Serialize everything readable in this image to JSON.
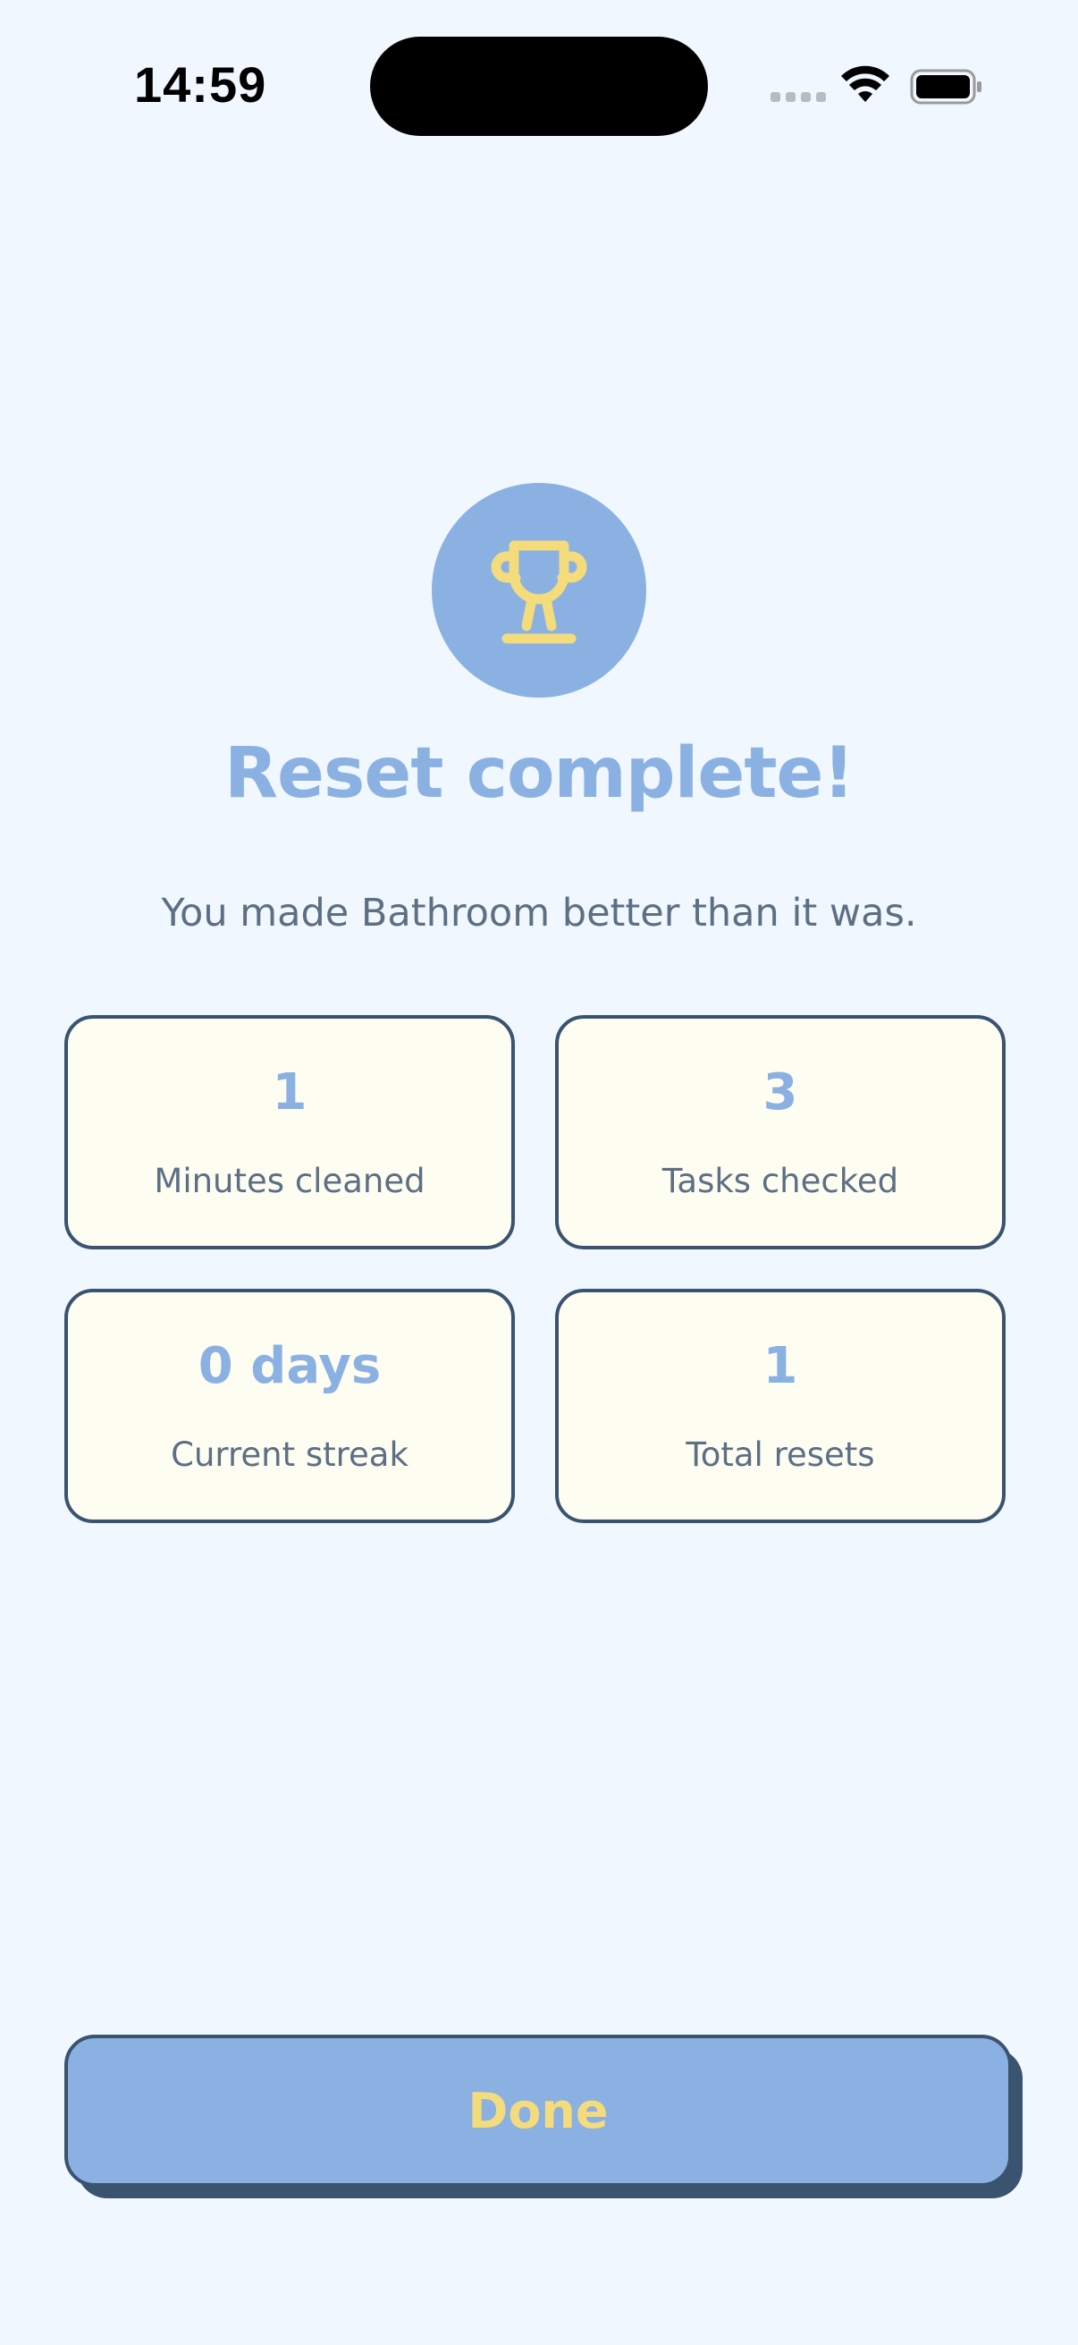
{
  "status_bar": {
    "time": "14:59",
    "icons": [
      "cellular-signal-icon",
      "wifi-icon",
      "battery-icon"
    ]
  },
  "header": {
    "icon": "trophy-icon",
    "title": "Reset complete!",
    "subtitle": "You made Bathroom better than it was."
  },
  "stats": [
    {
      "value": "1",
      "label": "Minutes cleaned"
    },
    {
      "value": "3",
      "label": "Tasks checked"
    },
    {
      "value": "0 days",
      "label": "Current streak"
    },
    {
      "value": "1",
      "label": "Total resets"
    }
  ],
  "actions": {
    "done_label": "Done"
  },
  "colors": {
    "background": "#F0F7FF",
    "accent_blue": "#8BB1E3",
    "accent_yellow": "#F4DB7C",
    "card_background": "#FEFDF2",
    "border_navy": "#3A536F",
    "text_muted": "#5C6F83"
  }
}
